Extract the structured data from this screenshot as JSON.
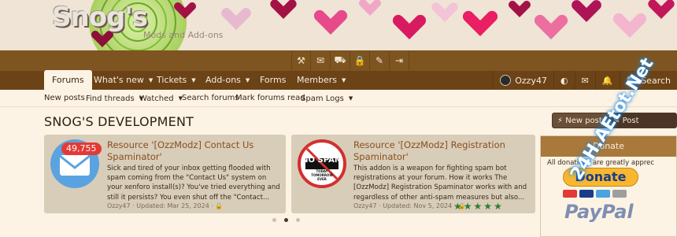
{
  "site": {
    "logo": "Snog's",
    "tagline": "Mods and Add-ons"
  },
  "toolbar_icons": [
    "tools-icon",
    "envelope-icon",
    "truck-icon",
    "lock-icon",
    "brush-icon",
    "sign-in-icon"
  ],
  "nav": {
    "items": [
      {
        "label": "Forums",
        "active": true
      },
      {
        "label": "What's new",
        "caret": true
      },
      {
        "label": "Tickets",
        "caret": true
      },
      {
        "label": "Add-ons",
        "caret": true
      },
      {
        "label": "Forms"
      },
      {
        "label": "Members",
        "caret": true
      }
    ],
    "user": "Ozzy47",
    "search": "Search"
  },
  "subnav": {
    "items": [
      "New posts",
      "Find threads",
      "Watched",
      "Search forums",
      "Mark forums read",
      "Spam Logs"
    ]
  },
  "page": {
    "title": "SNOG'S DEVELOPMENT",
    "new_posts": "New posts",
    "post_thread": "Post thread..."
  },
  "cards": [
    {
      "title": "Resource '[OzzModz] Contact Us Spaminator'",
      "badge": "49,755",
      "desc": "Sick and tired of your inbox getting flooded with spam coming from the \"Contact Us\" system on your xenforo install(s)? You've tried everything and still it persists? You even shut off the \"Contact...",
      "meta": "Ozzy47 · Updated: Mar 25, 2024 ·"
    },
    {
      "title": "Resource '[OzzModz] Registration Spaminator'",
      "logo_text": "NO SPAM",
      "logo_sub": "TODAY TOMORROW EVER",
      "desc": "This addon is a weapon for fighting spam bot registrations at your forum. How it works The [OzzModz] Registration Spaminator works with and regardless of other anti-spam measures but also...",
      "meta": "Ozzy47 · Updated: Nov 5, 2024 ·",
      "rating": 5
    }
  ],
  "donate": {
    "title": "Donate",
    "text": "All donations are greatly apprec",
    "button": "Donate",
    "paypal": "PayPal"
  },
  "watermark": "24H.AEtot.Net"
}
